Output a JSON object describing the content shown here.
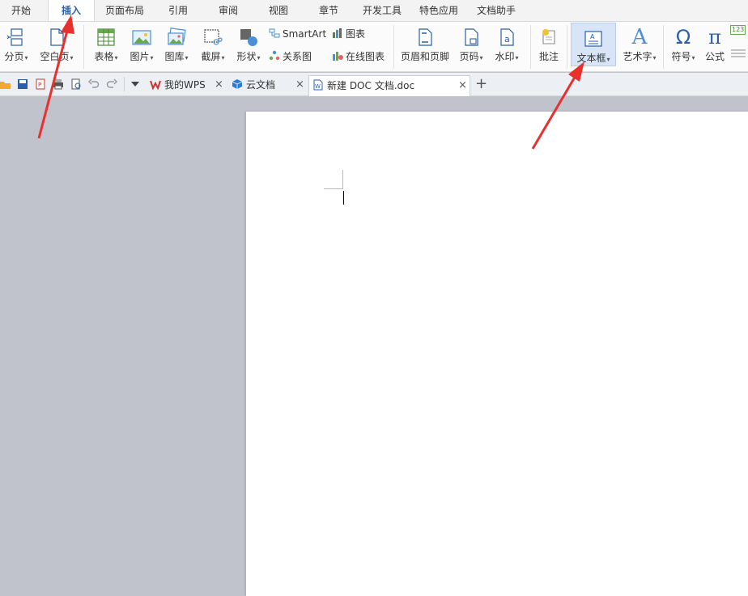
{
  "menu": {
    "tabs": [
      "开始",
      "插入",
      "页面布局",
      "引用",
      "审阅",
      "视图",
      "章节",
      "开发工具",
      "特色应用",
      "文档助手"
    ],
    "active_index": 1
  },
  "ribbon": {
    "page_break": "分页",
    "blank_page": "空白页",
    "table": "表格",
    "picture": "图片",
    "gallery": "图库",
    "screenshot": "截屏",
    "shapes": "形状",
    "smartart": "SmartArt",
    "chart": "图表",
    "relation": "关系图",
    "online_chart": "在线图表",
    "header_footer": "页眉和页脚",
    "page_number": "页码",
    "watermark": "水印",
    "comment": "批注",
    "textbox": "文本框",
    "wordart": "艺术字",
    "symbol": "符号",
    "formula": "公式",
    "caret": "▾",
    "wordart_glyph": "A",
    "symbol_glyph": "Ω",
    "formula_glyph": "π",
    "numbered_glyph": "123"
  },
  "tabs": {
    "my_wps": "我的WPS",
    "cloud": "云文档",
    "doc": "新建 DOC 文档.doc",
    "close": "×",
    "add": "+"
  },
  "colors": {
    "accent": "#2b5fab",
    "arrow": "#e8312d",
    "highlight": "#d7e5f7"
  }
}
